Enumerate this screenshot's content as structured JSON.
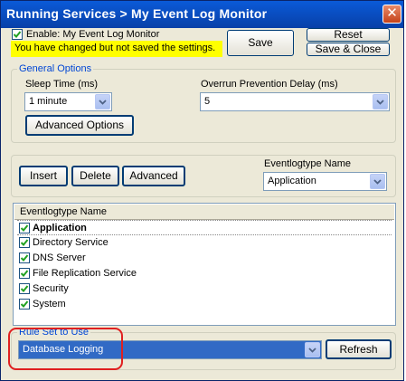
{
  "window": {
    "title": "Running Services > My Event Log Monitor",
    "close_icon": "close-icon"
  },
  "top": {
    "enable_label": "Enable: My Event Log Monitor",
    "enable_checked": true,
    "unsaved_note": "You have changed but not saved the settings.",
    "save_label": "Save",
    "reset_label": "Reset",
    "save_close_label": "Save & Close"
  },
  "general_options": {
    "legend": "General Options",
    "sleep_time_label": "Sleep Time (ms)",
    "sleep_time_value": "1 minute",
    "overrun_label": "Overrun Prevention Delay (ms)",
    "overrun_value": "5",
    "advanced_options_label": "Advanced Options"
  },
  "toolbar": {
    "insert_label": "Insert",
    "delete_label": "Delete",
    "advanced_label": "Advanced",
    "eventlogtype_label": "Eventlogtype Name",
    "eventlogtype_value": "Application"
  },
  "list": {
    "header": "Eventlogtype Name",
    "items": [
      {
        "label": "Application",
        "checked": true,
        "selected": true
      },
      {
        "label": "Directory Service",
        "checked": true,
        "selected": false
      },
      {
        "label": "DNS Server",
        "checked": true,
        "selected": false
      },
      {
        "label": "File Replication Service",
        "checked": true,
        "selected": false
      },
      {
        "label": "Security",
        "checked": true,
        "selected": false
      },
      {
        "label": "System",
        "checked": true,
        "selected": false
      }
    ]
  },
  "rule_set": {
    "legend": "Rule Set to Use",
    "value": "Database Logging",
    "refresh_label": "Refresh"
  },
  "colors": {
    "titlebar": "#0a5ad8",
    "selection": "#316ac5",
    "note_background": "#ffff00",
    "legend_text": "#0046d5",
    "annotation_circle": "#e02020"
  }
}
